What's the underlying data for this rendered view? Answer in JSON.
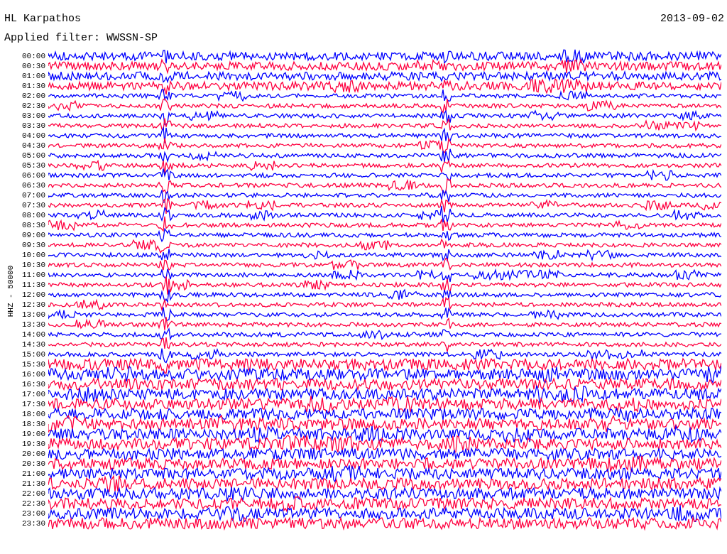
{
  "title": "HL Karpathos",
  "date": "2013-09-02",
  "filter": "Applied filter: WWSSN-SP",
  "axis_label": "HHZ - 50000",
  "rows": [
    {
      "time": "00:00",
      "color": "#0000ff"
    },
    {
      "time": "00:30",
      "color": "#ff0040"
    },
    {
      "time": "01:00",
      "color": "#0000ff"
    },
    {
      "time": "01:30",
      "color": "#ff0040"
    },
    {
      "time": "02:00",
      "color": "#0000ff"
    },
    {
      "time": "02:30",
      "color": "#ff0040"
    },
    {
      "time": "03:00",
      "color": "#0000ff"
    },
    {
      "time": "03:30",
      "color": "#ff0040"
    },
    {
      "time": "04:00",
      "color": "#0000ff"
    },
    {
      "time": "04:30",
      "color": "#ff0040"
    },
    {
      "time": "05:00",
      "color": "#0000ff"
    },
    {
      "time": "05:30",
      "color": "#ff0040"
    },
    {
      "time": "06:00",
      "color": "#0000ff"
    },
    {
      "time": "06:30",
      "color": "#ff0040"
    },
    {
      "time": "07:00",
      "color": "#0000ff"
    },
    {
      "time": "07:30",
      "color": "#ff0040"
    },
    {
      "time": "08:00",
      "color": "#0000ff"
    },
    {
      "time": "08:30",
      "color": "#ff0040"
    },
    {
      "time": "09:00",
      "color": "#0000ff"
    },
    {
      "time": "09:30",
      "color": "#ff0040"
    },
    {
      "time": "10:00",
      "color": "#0000ff"
    },
    {
      "time": "10:30",
      "color": "#ff0040"
    },
    {
      "time": "11:00",
      "color": "#0000ff"
    },
    {
      "time": "11:30",
      "color": "#ff0040"
    },
    {
      "time": "12:00",
      "color": "#0000ff"
    },
    {
      "time": "12:30",
      "color": "#ff0040"
    },
    {
      "time": "13:00",
      "color": "#0000ff"
    },
    {
      "time": "13:30",
      "color": "#ff0040"
    },
    {
      "time": "14:00",
      "color": "#0000ff"
    },
    {
      "time": "14:30",
      "color": "#ff0040"
    },
    {
      "time": "15:00",
      "color": "#0000ff"
    },
    {
      "time": "15:30",
      "color": "#ff0040"
    },
    {
      "time": "16:00",
      "color": "#0000ff"
    },
    {
      "time": "16:30",
      "color": "#ff0040"
    },
    {
      "time": "17:00",
      "color": "#0000ff"
    },
    {
      "time": "17:30",
      "color": "#ff0040"
    },
    {
      "time": "18:00",
      "color": "#0000ff"
    },
    {
      "time": "18:30",
      "color": "#ff0040"
    },
    {
      "time": "19:00",
      "color": "#0000ff"
    },
    {
      "time": "19:30",
      "color": "#ff0040"
    },
    {
      "time": "20:00",
      "color": "#0000ff"
    },
    {
      "time": "20:30",
      "color": "#ff0040"
    },
    {
      "time": "21:00",
      "color": "#0000ff"
    },
    {
      "time": "21:30",
      "color": "#ff0040"
    },
    {
      "time": "22:00",
      "color": "#0000ff"
    },
    {
      "time": "22:30",
      "color": "#ff0040"
    },
    {
      "time": "23:00",
      "color": "#0000ff"
    },
    {
      "time": "23:30",
      "color": "#ff0040"
    }
  ]
}
